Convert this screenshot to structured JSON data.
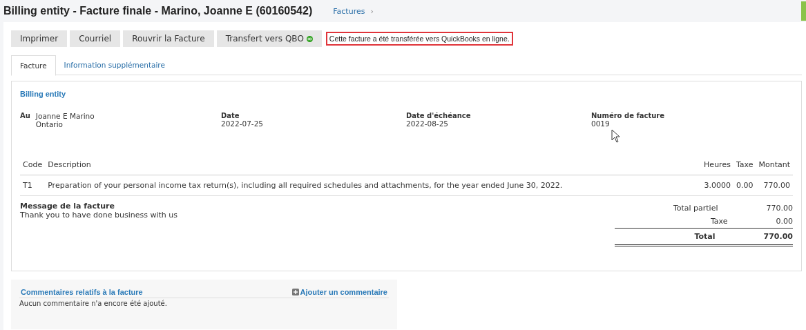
{
  "header": {
    "title": "Billing entity - Facture finale - Marino, Joanne E (60160542)",
    "breadcrumb": "Factures",
    "breadcrumb_separator": "›"
  },
  "toolbar": {
    "buttons": [
      {
        "label": "Imprimer",
        "kind": "plain"
      },
      {
        "label": "Courriel",
        "kind": "plain"
      },
      {
        "label": "Rouvrir la Facture",
        "kind": "plain"
      },
      {
        "label": "Transfert vers QBO",
        "kind": "qbo"
      }
    ],
    "notice": "Cette facture a été transférée vers QuickBooks en ligne."
  },
  "tabs": [
    {
      "label": "Facture",
      "selected": true
    },
    {
      "label": "Information supplémentaire",
      "selected": false
    }
  ],
  "invoice": {
    "entity": "Billing entity",
    "to_label": "Au",
    "to_lines": [
      "Joanne E Marino",
      "Ontario"
    ],
    "fields": [
      {
        "label": "Date",
        "value": "2022-07-25"
      },
      {
        "label": "Date d'échéance",
        "value": "2022-08-25"
      },
      {
        "label": "Numéro de facture",
        "value": "0019"
      }
    ],
    "columns": [
      "Code",
      "Description",
      "Heures",
      "Taxe",
      "Montant"
    ],
    "rows": [
      [
        "T1",
        "Preparation of your personal income tax return(s), including all required schedules and attachments, for the year ended June 30, 2022.",
        "3.0000",
        "0.00",
        "770.00"
      ]
    ],
    "message_label": "Message de la facture",
    "message": "Thank you to have done business with us",
    "totals": [
      {
        "label": "Total partiel",
        "value": "770.00",
        "kind": "normal"
      },
      {
        "label": "Taxe",
        "value": "0.00",
        "kind": "normal"
      },
      {
        "label": "Total",
        "value": "770.00",
        "kind": "grand"
      }
    ]
  },
  "comments": {
    "title": "Commentaires relatifs à la facture",
    "add": "Ajouter un commentaire",
    "empty": "Aucun commentaire n'a encore été ajouté."
  }
}
